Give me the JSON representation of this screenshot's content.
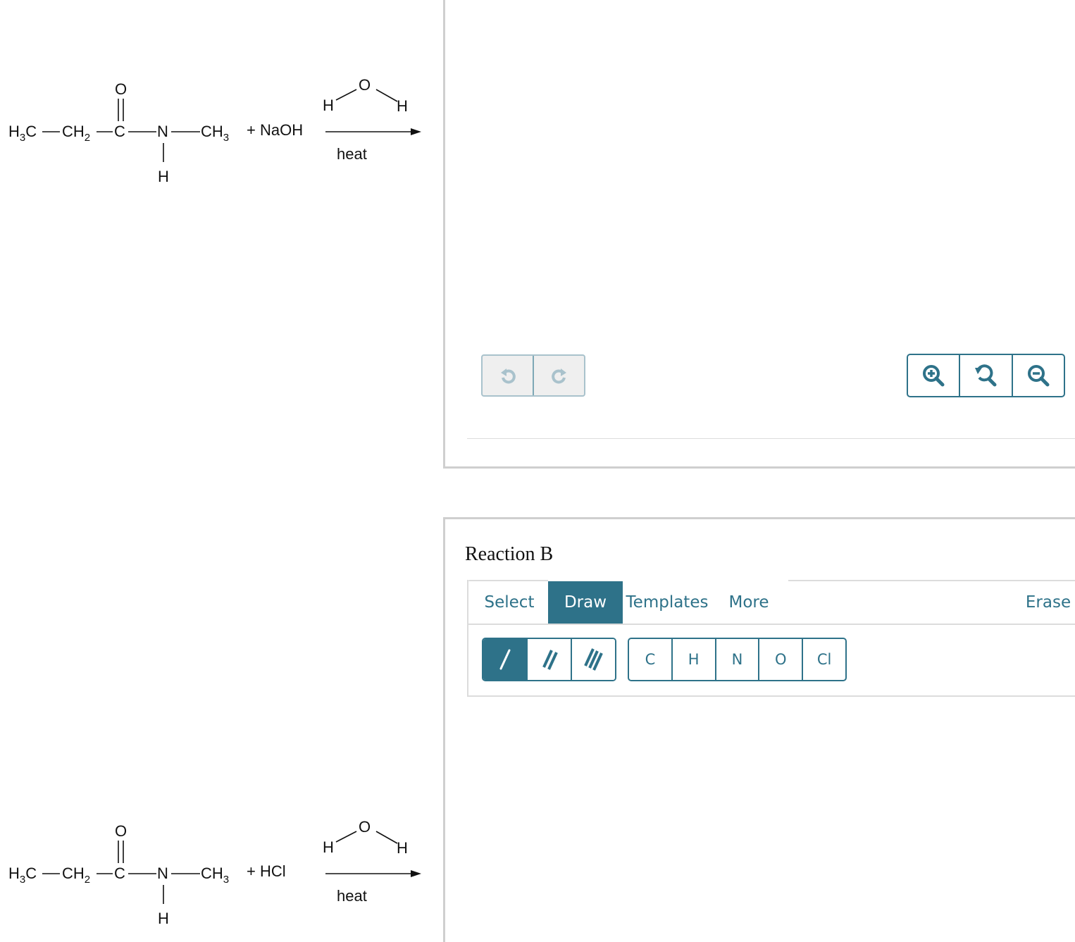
{
  "reaction_a_scheme": {
    "reactant": {
      "chain": [
        "H3C",
        "CH2",
        "C",
        "N",
        "CH3"
      ],
      "carbonyl_o": "O",
      "n_h": "H"
    },
    "reagent": "+ NaOH",
    "solvent": {
      "o": "O",
      "h_left": "H",
      "h_right": "H"
    },
    "condition": "heat"
  },
  "reaction_b_scheme": {
    "reactant": {
      "chain": [
        "H3C",
        "CH2",
        "C",
        "N",
        "CH3"
      ],
      "carbonyl_o": "O",
      "n_h": "H"
    },
    "reagent": "+ HCl",
    "solvent": {
      "o": "O",
      "h_left": "H",
      "h_right": "H"
    },
    "condition": "heat"
  },
  "panel_a": {
    "history": [
      {
        "name": "undo",
        "icon": "undo-icon",
        "enabled": false
      },
      {
        "name": "redo",
        "icon": "redo-icon",
        "enabled": false
      }
    ],
    "zoom_controls": [
      {
        "name": "zoom-in",
        "icon": "zoom-in-icon"
      },
      {
        "name": "zoom-reset",
        "icon": "zoom-reset-icon"
      },
      {
        "name": "zoom-out",
        "icon": "zoom-out-icon"
      }
    ]
  },
  "panel_b": {
    "title": "Reaction B",
    "tabs": [
      {
        "label": "Select",
        "active": false
      },
      {
        "label": "Draw",
        "active": true
      },
      {
        "label": "Templates",
        "active": false
      },
      {
        "label": "More",
        "active": false
      }
    ],
    "erase_label": "Erase",
    "bond_tools": [
      {
        "name": "single-bond",
        "active": true
      },
      {
        "name": "double-bond",
        "active": false
      },
      {
        "name": "triple-bond",
        "active": false
      }
    ],
    "atoms": [
      "C",
      "H",
      "N",
      "O",
      "Cl"
    ]
  },
  "colors": {
    "accent": "#2e7289",
    "disabled": "#a9c2cc",
    "border": "#cfcfcf"
  }
}
